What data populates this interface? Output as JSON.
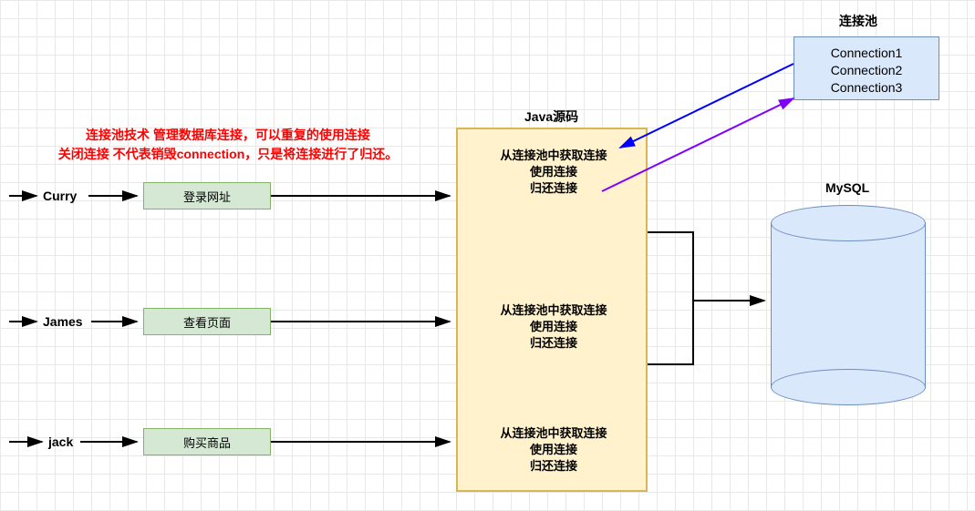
{
  "notes": {
    "line1": "连接池技术 管理数据库连接，可以重复的使用连接",
    "line2": "关闭连接 不代表销毁connection，只是将连接进行了归还。"
  },
  "users": [
    {
      "name": "Curry",
      "action": "登录网址"
    },
    {
      "name": "James",
      "action": "查看页面"
    },
    {
      "name": "jack",
      "action": "购买商品"
    }
  ],
  "java": {
    "title": "Java源码",
    "block1": {
      "l1": "从连接池中获取连接",
      "l2": "使用连接",
      "l3": "归还连接"
    },
    "block2": {
      "l1": "从连接池中获取连接",
      "l2": "使用连接",
      "l3": "归还连接"
    },
    "block3": {
      "l1": "从连接池中获取连接",
      "l2": "使用连接",
      "l3": "归还连接"
    }
  },
  "pool": {
    "title": "连接池",
    "c1": "Connection1",
    "c2": "Connection2",
    "c3": "Connection3"
  },
  "db": {
    "title": "MySQL"
  }
}
